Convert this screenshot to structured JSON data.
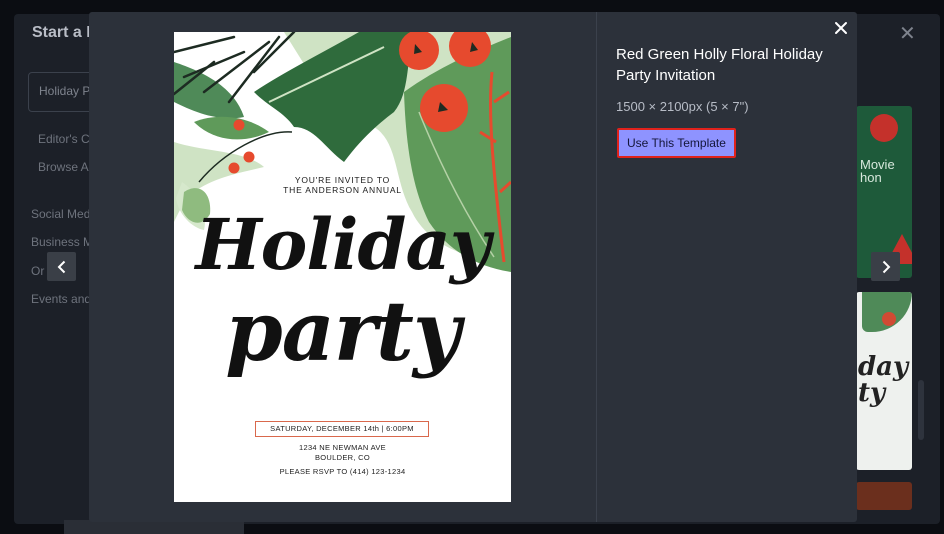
{
  "background": {
    "title": "Start a D",
    "search_value": "Holiday P",
    "sidebar": [
      {
        "label": "Editor's C"
      },
      {
        "label": "Browse A"
      },
      {
        "label": "Social Med"
      },
      {
        "label": "Business M"
      },
      {
        "label": "Or   dv"
      },
      {
        "label": "Events and"
      }
    ],
    "card1_text": [
      "Movie",
      "hon"
    ],
    "card2_text": [
      "day",
      "ty"
    ]
  },
  "modal": {
    "title": "Red Green Holly Floral Holiday Party Invitation",
    "dimensions": "1500 × 2100px (5 × 7\")",
    "use_button": "Use This Template",
    "close_icon": "close-icon",
    "prev_icon": "chevron-left-icon",
    "next_icon": "chevron-right-icon"
  },
  "invitation": {
    "line1": "YOU'RE INVITED TO",
    "line2": "THE ANDERSON ANNUAL",
    "script1": "Holiday",
    "script2": "party",
    "date": "SATURDAY, DECEMBER 14th | 6:00PM",
    "address1": "1234 NE NEWMAN AVE",
    "address2": "BOULDER, CO",
    "rsvp": "PLEASE RSVP TO (414) 123-1234",
    "colors": {
      "leaf_dark": "#2f6b3c",
      "leaf_mid": "#5f9a5a",
      "leaf_light": "#cfe3c4",
      "berry": "#e64a2e"
    }
  }
}
